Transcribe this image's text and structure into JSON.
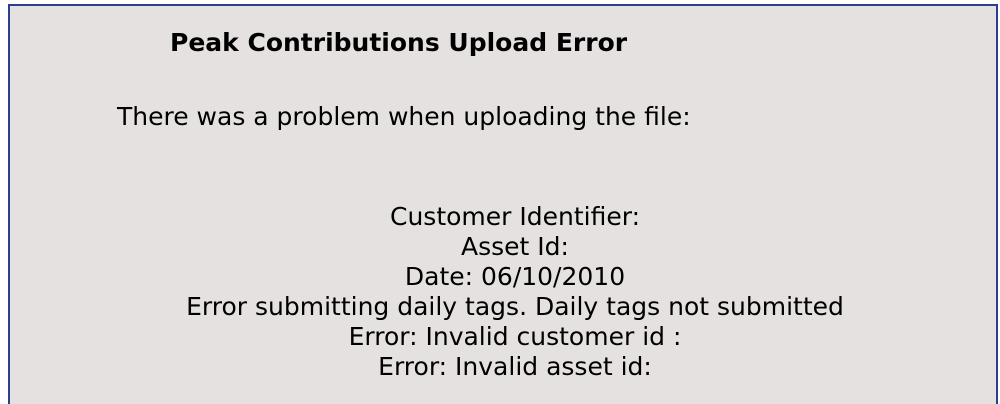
{
  "dialog": {
    "title": "Peak Contributions Upload Error",
    "intro": "There was a problem when uploading the file:",
    "details": {
      "customer_identifier": "Customer Identifier:",
      "asset_id": "Asset Id:",
      "date": "Date: 06/10/2010",
      "submit_error": "Error submitting daily tags. Daily tags not submitted",
      "invalid_customer": "Error: Invalid customer id :",
      "invalid_asset": "Error: Invalid asset id:"
    }
  }
}
